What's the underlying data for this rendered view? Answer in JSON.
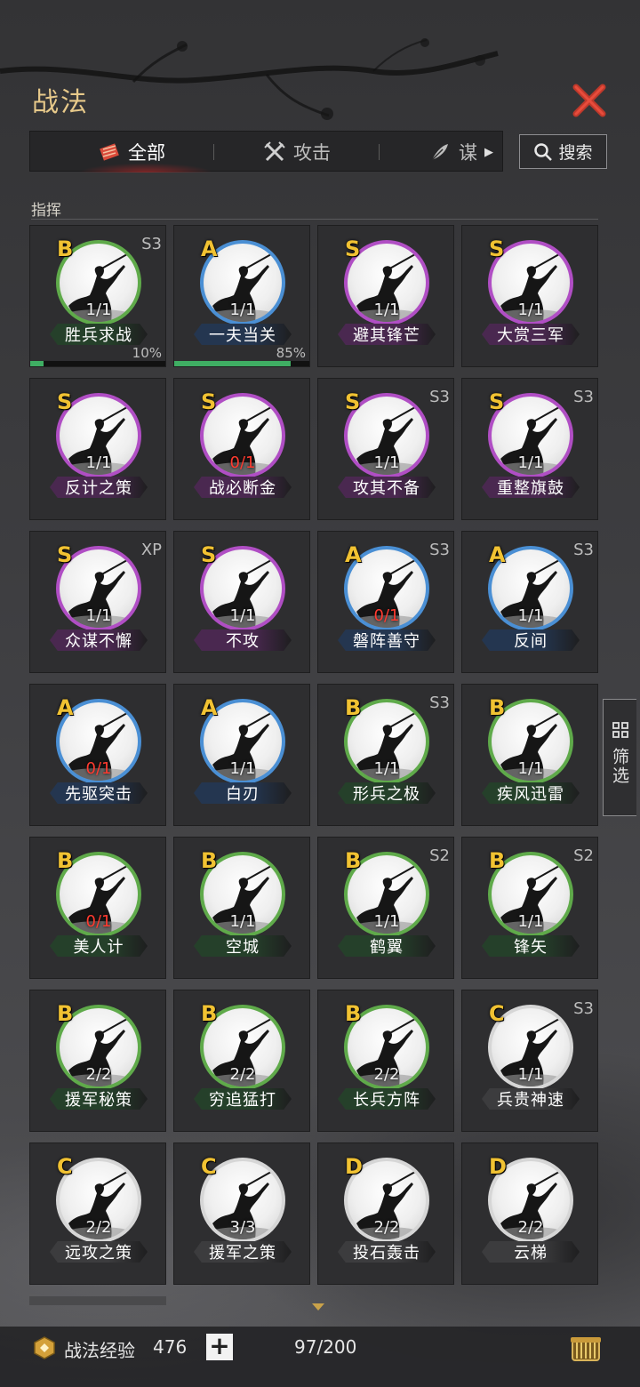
{
  "header": {
    "title": "战法"
  },
  "tabs": [
    {
      "label": "全部",
      "icon": "scroll-bundle-icon",
      "active": true
    },
    {
      "label": "攻击",
      "icon": "crossed-swords-icon",
      "active": false
    },
    {
      "label": "谋",
      "icon": "feather-icon",
      "active": false
    }
  ],
  "search": {
    "label": "搜索"
  },
  "section": {
    "title": "指挥"
  },
  "cards": [
    {
      "grade": "B",
      "count": "1/1",
      "name": "胜兵求战",
      "tag": "S3",
      "progress_pct": 10,
      "progress_label": "10%"
    },
    {
      "grade": "A",
      "count": "1/1",
      "name": "一夫当关",
      "tag": "",
      "progress_pct": 85,
      "progress_label": "85%"
    },
    {
      "grade": "S",
      "count": "1/1",
      "name": "避其锋芒",
      "tag": ""
    },
    {
      "grade": "S",
      "count": "1/1",
      "name": "大赏三军",
      "tag": ""
    },
    {
      "grade": "S",
      "count": "1/1",
      "name": "反计之策",
      "tag": ""
    },
    {
      "grade": "S",
      "count": "0/1",
      "name": "战必断金",
      "tag": ""
    },
    {
      "grade": "S",
      "count": "1/1",
      "name": "攻其不备",
      "tag": "S3"
    },
    {
      "grade": "S",
      "count": "1/1",
      "name": "重整旗鼓",
      "tag": "S3"
    },
    {
      "grade": "S",
      "count": "1/1",
      "name": "众谋不懈",
      "tag": "XP"
    },
    {
      "grade": "S",
      "count": "1/1",
      "name": "不攻",
      "tag": ""
    },
    {
      "grade": "A",
      "count": "0/1",
      "name": "磐阵善守",
      "tag": "S3"
    },
    {
      "grade": "A",
      "count": "1/1",
      "name": "反间",
      "tag": "S3"
    },
    {
      "grade": "A",
      "count": "0/1",
      "name": "先驱突击",
      "tag": ""
    },
    {
      "grade": "A",
      "count": "1/1",
      "name": "白刃",
      "tag": ""
    },
    {
      "grade": "B",
      "count": "1/1",
      "name": "形兵之极",
      "tag": "S3"
    },
    {
      "grade": "B",
      "count": "1/1",
      "name": "疾风迅雷",
      "tag": ""
    },
    {
      "grade": "B",
      "count": "0/1",
      "name": "美人计",
      "tag": ""
    },
    {
      "grade": "B",
      "count": "1/1",
      "name": "空城",
      "tag": ""
    },
    {
      "grade": "B",
      "count": "1/1",
      "name": "鹤翼",
      "tag": "S2"
    },
    {
      "grade": "B",
      "count": "1/1",
      "name": "锋矢",
      "tag": "S2"
    },
    {
      "grade": "B",
      "count": "2/2",
      "name": "援军秘策",
      "tag": ""
    },
    {
      "grade": "B",
      "count": "2/2",
      "name": "穷追猛打",
      "tag": ""
    },
    {
      "grade": "B",
      "count": "2/2",
      "name": "长兵方阵",
      "tag": ""
    },
    {
      "grade": "C",
      "count": "1/1",
      "name": "兵贵神速",
      "tag": "S3"
    },
    {
      "grade": "C",
      "count": "2/2",
      "name": "远攻之策",
      "tag": ""
    },
    {
      "grade": "C",
      "count": "3/3",
      "name": "援军之策",
      "tag": ""
    },
    {
      "grade": "D",
      "count": "2/2",
      "name": "投石轰击",
      "tag": ""
    },
    {
      "grade": "D",
      "count": "2/2",
      "name": "云梯",
      "tag": ""
    }
  ],
  "grade_colors": {
    "S": {
      "ring": "#b04ec4",
      "banner": "#4a2850"
    },
    "A": {
      "ring": "#4a8fd4",
      "banner": "#243650"
    },
    "B": {
      "ring": "#5faa4a",
      "banner": "#25402a"
    },
    "C": {
      "ring": "#d6d6d6",
      "banner": "#3c3c3e"
    },
    "D": {
      "ring": "#d6d6d6",
      "banner": "#3c3c3e"
    }
  },
  "filter": {
    "label": "筛选"
  },
  "footer": {
    "exp_label": "战法经验",
    "exp_value": "476",
    "plus_label": "+",
    "capacity": "97/200"
  }
}
